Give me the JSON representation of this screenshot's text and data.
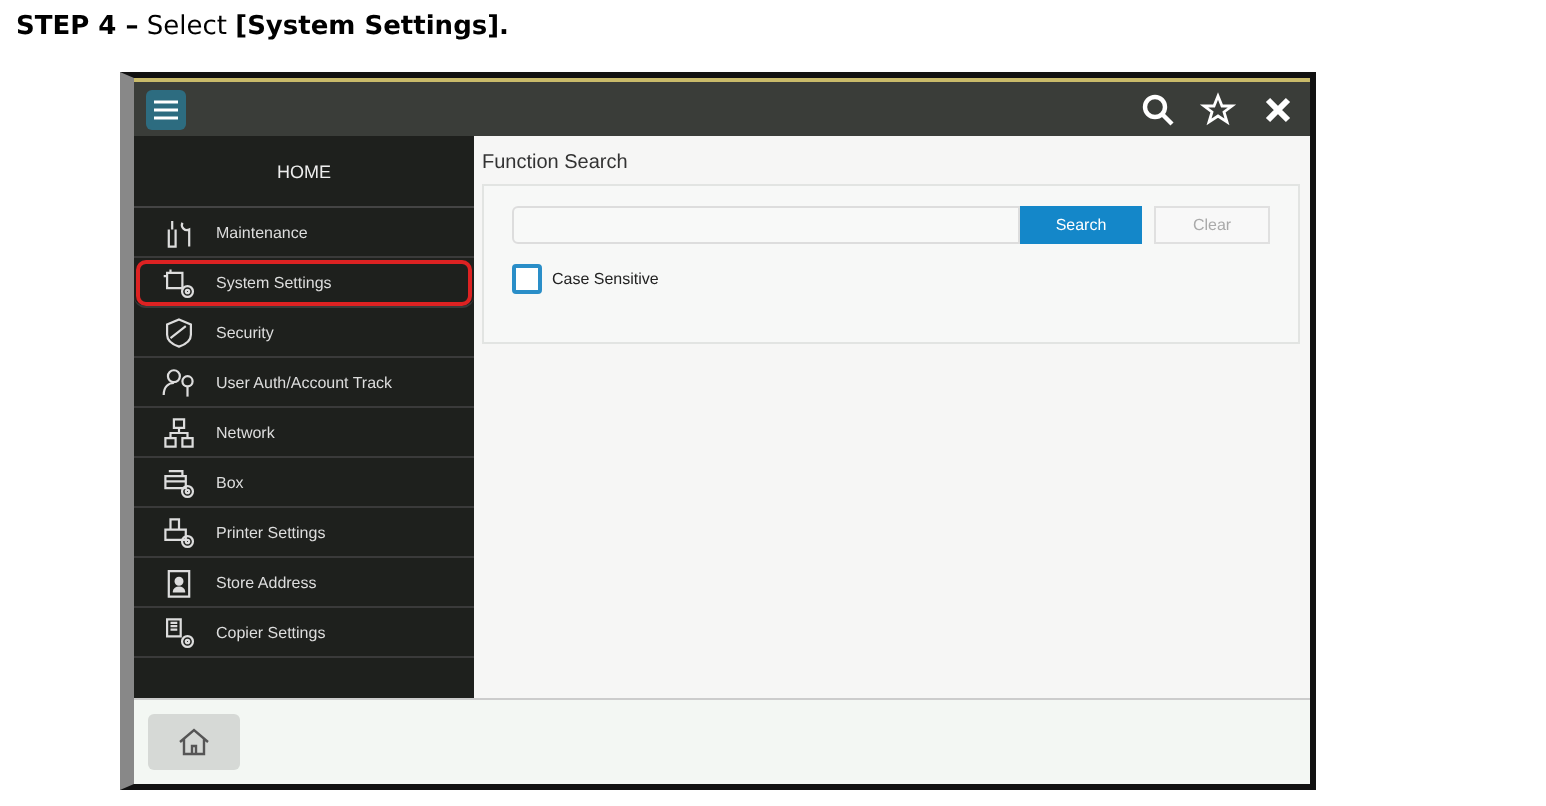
{
  "heading": "**STEP 4 –** Select **[System Settings].**",
  "sidebar": {
    "title": "HOME",
    "items": [
      {
        "label": "Maintenance",
        "highlighted": false
      },
      {
        "label": "System Settings",
        "highlighted": true
      },
      {
        "label": "Security",
        "highlighted": false
      },
      {
        "label": "User Auth/Account Track",
        "highlighted": false
      },
      {
        "label": "Network",
        "highlighted": false
      },
      {
        "label": "Box",
        "highlighted": false
      },
      {
        "label": "Printer Settings",
        "highlighted": false
      },
      {
        "label": "Store Address",
        "highlighted": false
      },
      {
        "label": "Copier Settings",
        "highlighted": false
      }
    ]
  },
  "panel": {
    "title": "Function Search",
    "search_button": "Search",
    "clear_button": "Clear",
    "checkbox": {
      "label": "Case Sensitive",
      "checked": false
    }
  }
}
